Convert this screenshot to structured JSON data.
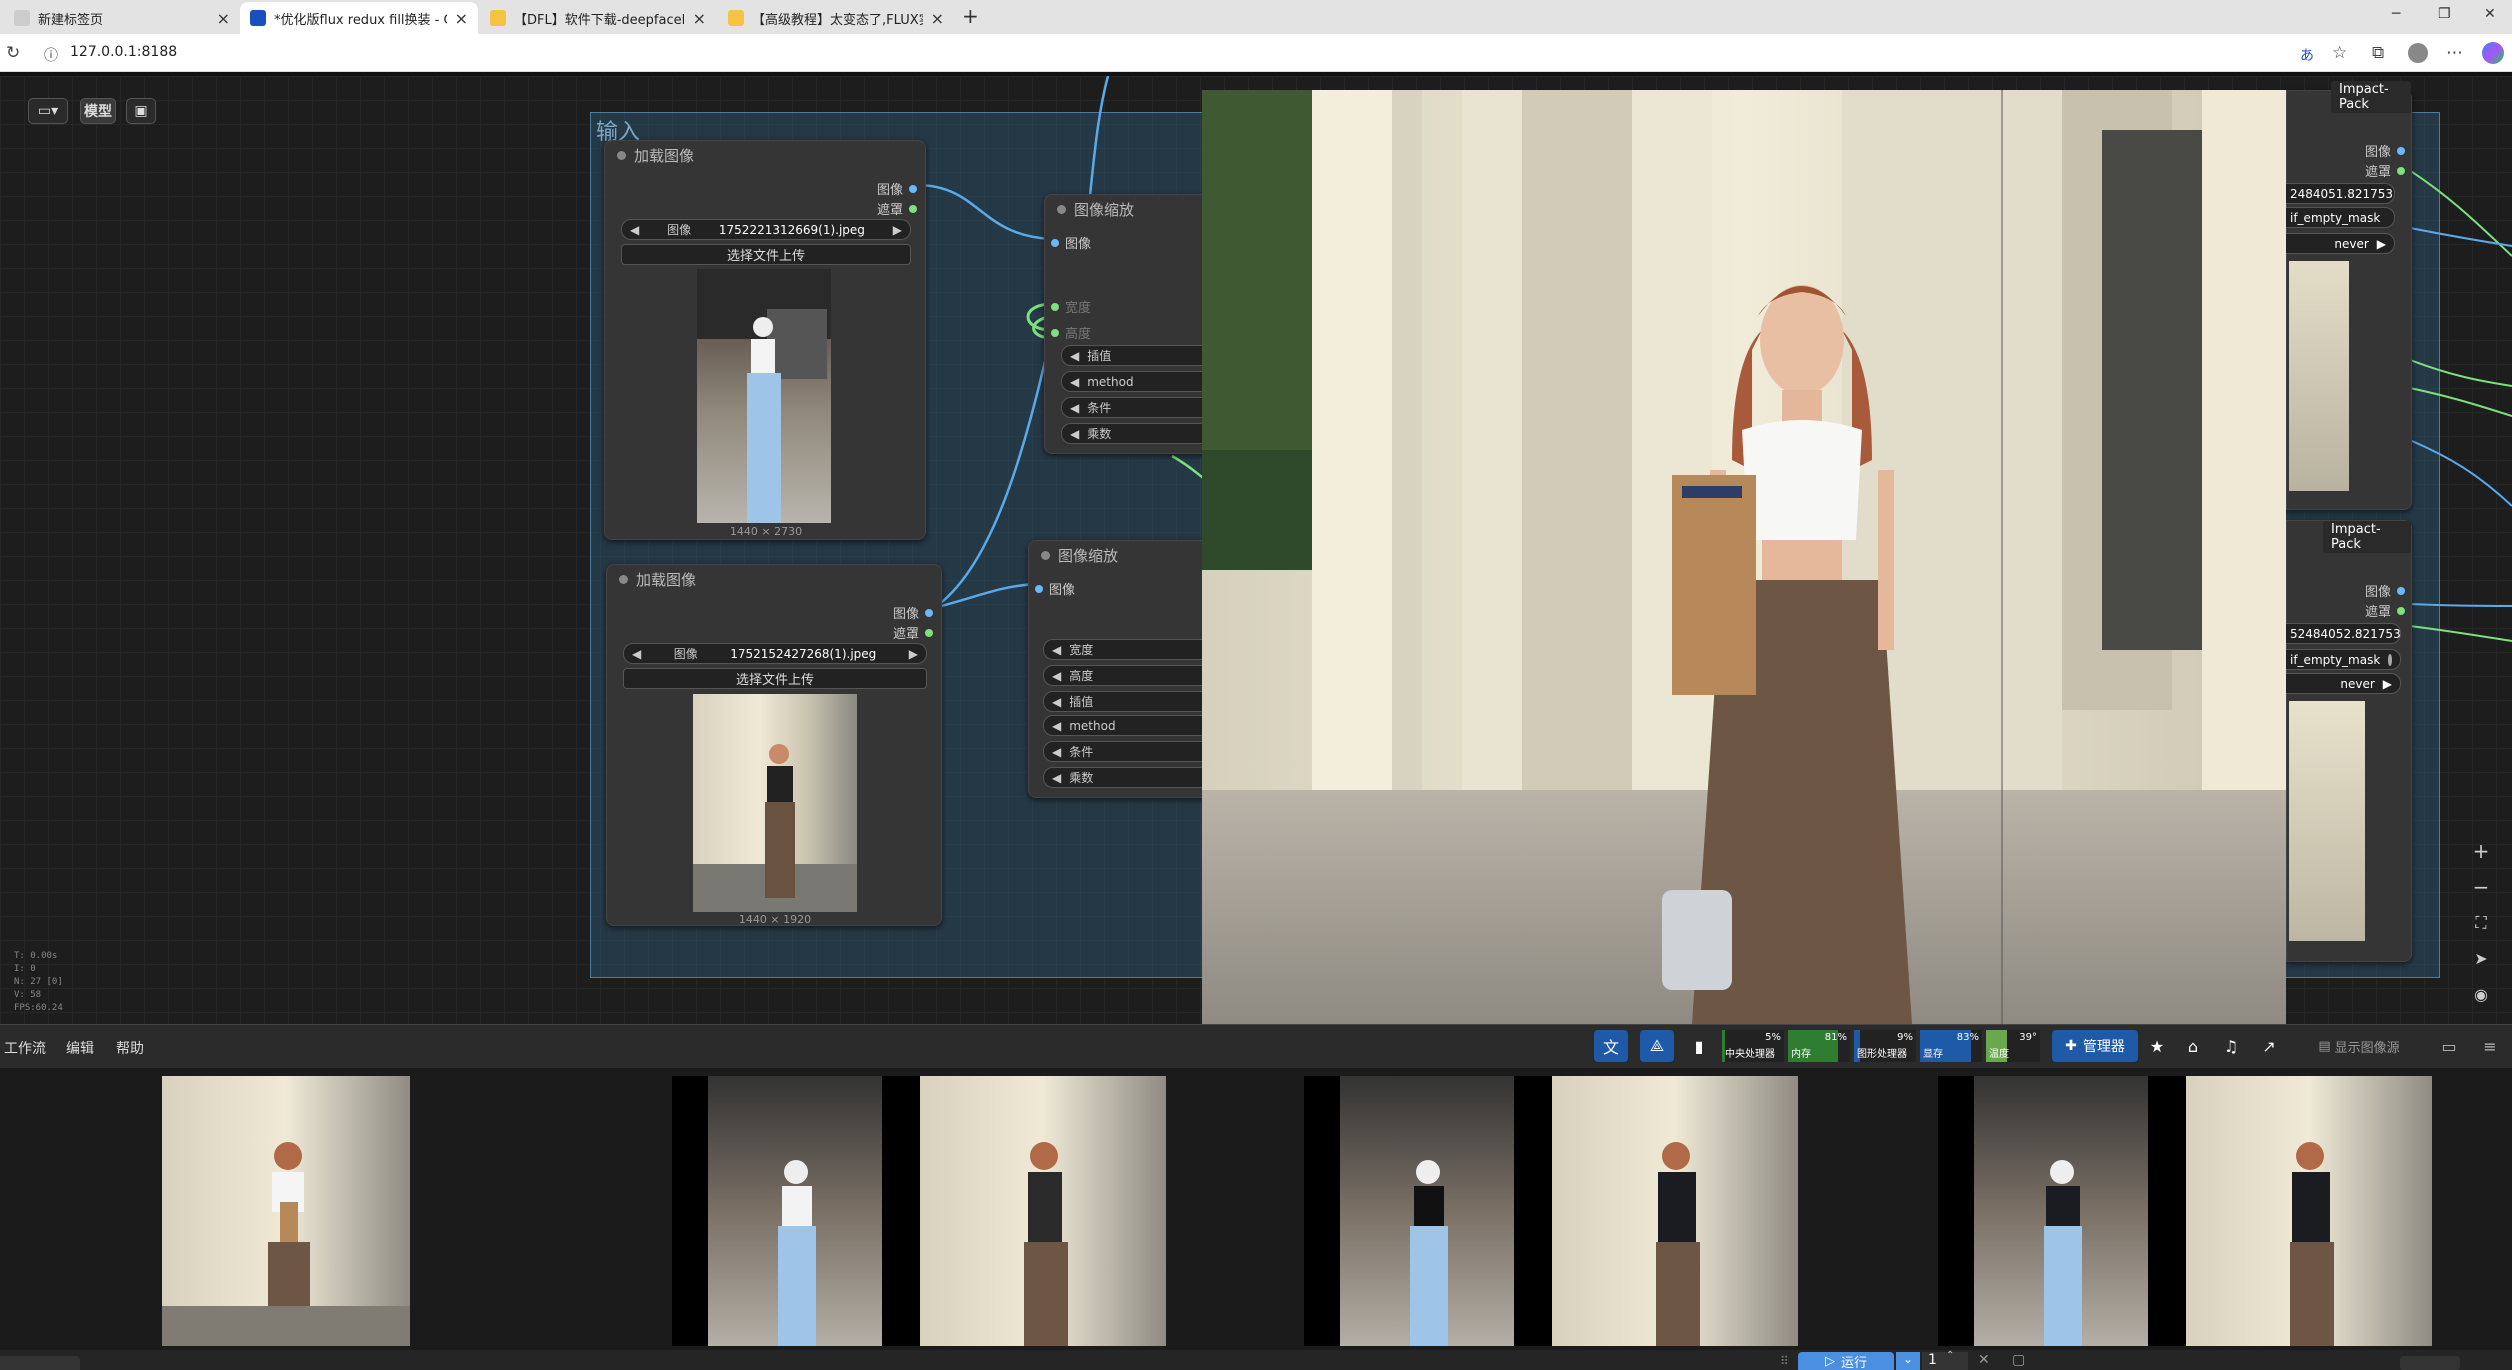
{
  "browser": {
    "tabs": [
      {
        "label": "新建标签页",
        "active": false
      },
      {
        "label": "*优化版flux redux fill换装 - Comfy",
        "active": true
      },
      {
        "label": "【DFL】软件下载-deepfacelab中",
        "active": false
      },
      {
        "label": "【高级教程】太变态了,FLUX实现",
        "active": false
      }
    ],
    "url": "127.0.0.1:8188",
    "translate_label": "あ"
  },
  "canvas_toolbar": {
    "model_label": "模型"
  },
  "group": {
    "title": "输入"
  },
  "nodes": {
    "load1": {
      "title": "加载图像",
      "out_image": "图像",
      "out_mask": "遮罩",
      "widget_label": "图像",
      "filename": "1752221312669(1).jpeg",
      "upload_label": "选择文件上传",
      "dimensions": "1440 × 2730"
    },
    "load2": {
      "title": "加载图像",
      "out_image": "图像",
      "out_mask": "遮罩",
      "widget_label": "图像",
      "filename": "1752152427268(1).jpeg",
      "upload_label": "选择文件上传",
      "dimensions": "1440 × 1920"
    },
    "scale1": {
      "title": "图像缩放",
      "in_image": "图像",
      "ports": [
        "宽度",
        "高度"
      ],
      "widgets": [
        "插值",
        "method",
        "条件",
        "乘数"
      ]
    },
    "scale2": {
      "title": "图像缩放",
      "in_image": "图像",
      "widgets": [
        "宽度",
        "高度",
        "插值",
        "method",
        "条件",
        "乘数"
      ]
    },
    "impact1": {
      "title": "Impact-Pack",
      "out_image": "图像",
      "out_mask": "遮罩",
      "value": "2484051.821753",
      "toggle_label": "if_empty_mask",
      "mode": "never"
    },
    "impact2": {
      "title": "Impact-Pack",
      "out_image": "图像",
      "out_mask": "遮罩",
      "value": "52484052.821753",
      "toggle_label": "if_empty_mask",
      "mode": "never"
    }
  },
  "stats": {
    "t": "T: 0.00s",
    "i": "I: 0",
    "n": "N: 27 [0]",
    "v": "V: 58",
    "fps": "FPS:60.24"
  },
  "menubar": {
    "items": [
      "工作流",
      "编辑",
      "帮助"
    ],
    "meters": [
      {
        "label": "中央处理器",
        "percent": 5,
        "value_text": "5%",
        "color": "#2e7d32"
      },
      {
        "label": "内存",
        "percent": 81,
        "value_text": "81%",
        "color": "#2e7d32"
      },
      {
        "label": "图形处理器",
        "percent": 9,
        "value_text": "9%",
        "color": "#1e5aa8"
      },
      {
        "label": "显存",
        "percent": 83,
        "value_text": "83%",
        "color": "#1e5aa8"
      },
      {
        "label": "温度",
        "percent": 39,
        "value_text": "39°",
        "color": "#6aa84f"
      }
    ],
    "manager_label": "管理器",
    "show_image_source_label": "显示图像源"
  },
  "run": {
    "label": "运行",
    "count": "1"
  }
}
